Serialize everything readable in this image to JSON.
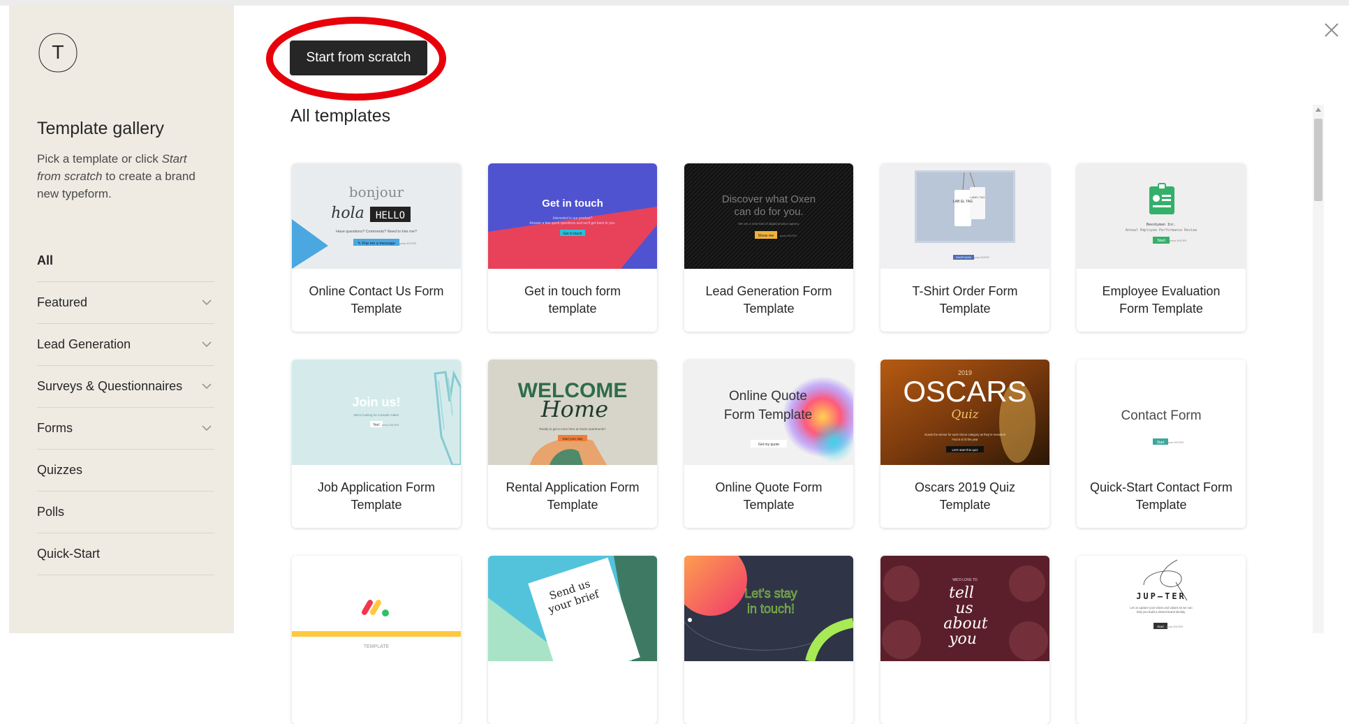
{
  "sidebar": {
    "logo_letter": "T",
    "title": "Template gallery",
    "desc_prefix": "Pick a template or click ",
    "desc_em": "Start from scratch",
    "desc_suffix": " to create a brand new typeform.",
    "categories": [
      {
        "label": "All",
        "active": true,
        "expandable": false
      },
      {
        "label": "Featured",
        "expandable": true
      },
      {
        "label": "Lead Generation",
        "expandable": true
      },
      {
        "label": "Surveys & Questionnaires",
        "expandable": true
      },
      {
        "label": "Forms",
        "expandable": true
      },
      {
        "label": "Quizzes",
        "expandable": false
      },
      {
        "label": "Polls",
        "expandable": false
      },
      {
        "label": "Quick-Start",
        "expandable": false
      }
    ]
  },
  "main": {
    "start_button": "Start from scratch",
    "section_title": "All templates",
    "highlight_color": "#e8000b",
    "templates": [
      {
        "title": "Online Contact Us Form Template",
        "thumb": {
          "bonjour": "bonjour",
          "hola": "hola",
          "hello": "HELLO",
          "q": "Have questions? Comments? Need to hire me?",
          "btn": "✎ Pop me a message",
          "hint": "press ENTER"
        }
      },
      {
        "title": "Get in touch form template",
        "thumb": {
          "heading": "Get in touch",
          "sub1": "Interested in our product?",
          "sub2": "Answer a few quick questions and we'll get back to you.",
          "btn": "Get in touch"
        }
      },
      {
        "title": "Lead Generation Form Template",
        "thumb": {
          "heading1": "Discover what Oxen",
          "heading2": "can do for you.",
          "sub": "We are a new kind of digital product agency",
          "btn": "Show me",
          "hint": "press ENTER"
        }
      },
      {
        "title": "T-Shirt Order Form Template",
        "thumb": {
          "tag1": "LAB EL TAG",
          "tag2": "LABEL TAG",
          "btn": "SHOP NOW",
          "hint": "press ENTER"
        }
      },
      {
        "title": "Employee Evaluation Form Template",
        "thumb": {
          "org": "Beesbyman Inc.",
          "sub": "Annual Employee Performance Review",
          "btn": "Start",
          "hint": "press ENTER"
        }
      },
      {
        "title": "Job Application Form Template",
        "thumb": {
          "heading": "Join us!",
          "sub": "We're looking for a breath maker",
          "btn": "Yes!",
          "hint": "press ENTER"
        }
      },
      {
        "title": "Rental Application Form Template",
        "thumb": {
          "heading1": "WELCOME",
          "heading2": "Home",
          "sub": "Ready to get a room here at Oasis Apartments?",
          "btn": "Start your stay"
        }
      },
      {
        "title": "Online Quote Form Template",
        "thumb": {
          "heading1": "Online Quote",
          "heading2": "Form Template",
          "btn": "Get my quote"
        }
      },
      {
        "title": "Oscars 2019 Quiz Template",
        "thumb": {
          "year": "2019",
          "heading": "OSCARS",
          "script": "Quiz",
          "sub1": "Guess the winner for each Oscar category as they're revealed!",
          "sub2": "Find 8 of of the year",
          "btn": "Let's start this quiz"
        }
      },
      {
        "title": "Quick-Start Contact Form Template",
        "thumb": {
          "heading": "Contact Form",
          "btn": "Start",
          "hint": "press ENTER"
        }
      },
      {
        "title": "",
        "thumb": {
          "hint": "TEMPLATE"
        }
      },
      {
        "title": "",
        "thumb": {
          "heading1": "Send us",
          "heading2": "your brief"
        }
      },
      {
        "title": "",
        "thumb": {
          "heading1": "Let's stay",
          "heading2": "in touch!"
        }
      },
      {
        "title": "",
        "thumb": {
          "arc": "WE'D LOVE TO",
          "script1": "tell",
          "script2": "us",
          "script3": "about",
          "script4": "you"
        }
      },
      {
        "title": "",
        "thumb": {
          "brand": "JUP—TER",
          "sub1": "Let us capture your vision and values so we can",
          "sub2": "help you build a vibrant brand identity.",
          "btn": "Start",
          "hint": "press ENTER"
        }
      }
    ]
  }
}
